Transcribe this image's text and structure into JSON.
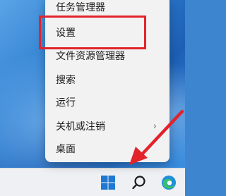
{
  "context_menu": {
    "items": [
      {
        "label": "任务管理器"
      },
      {
        "label": "设置"
      },
      {
        "label": "文件资源管理器"
      },
      {
        "label": "搜索"
      },
      {
        "label": "运行"
      },
      {
        "label": "关机或注销",
        "has_submenu": true
      },
      {
        "label": "桌面"
      }
    ]
  },
  "annotations": {
    "highlight_color": "#e3232c",
    "arrow_color": "#e3232c"
  },
  "taskbar": {
    "icons": [
      "windows-start-icon",
      "search-icon",
      "edge-icon"
    ]
  }
}
